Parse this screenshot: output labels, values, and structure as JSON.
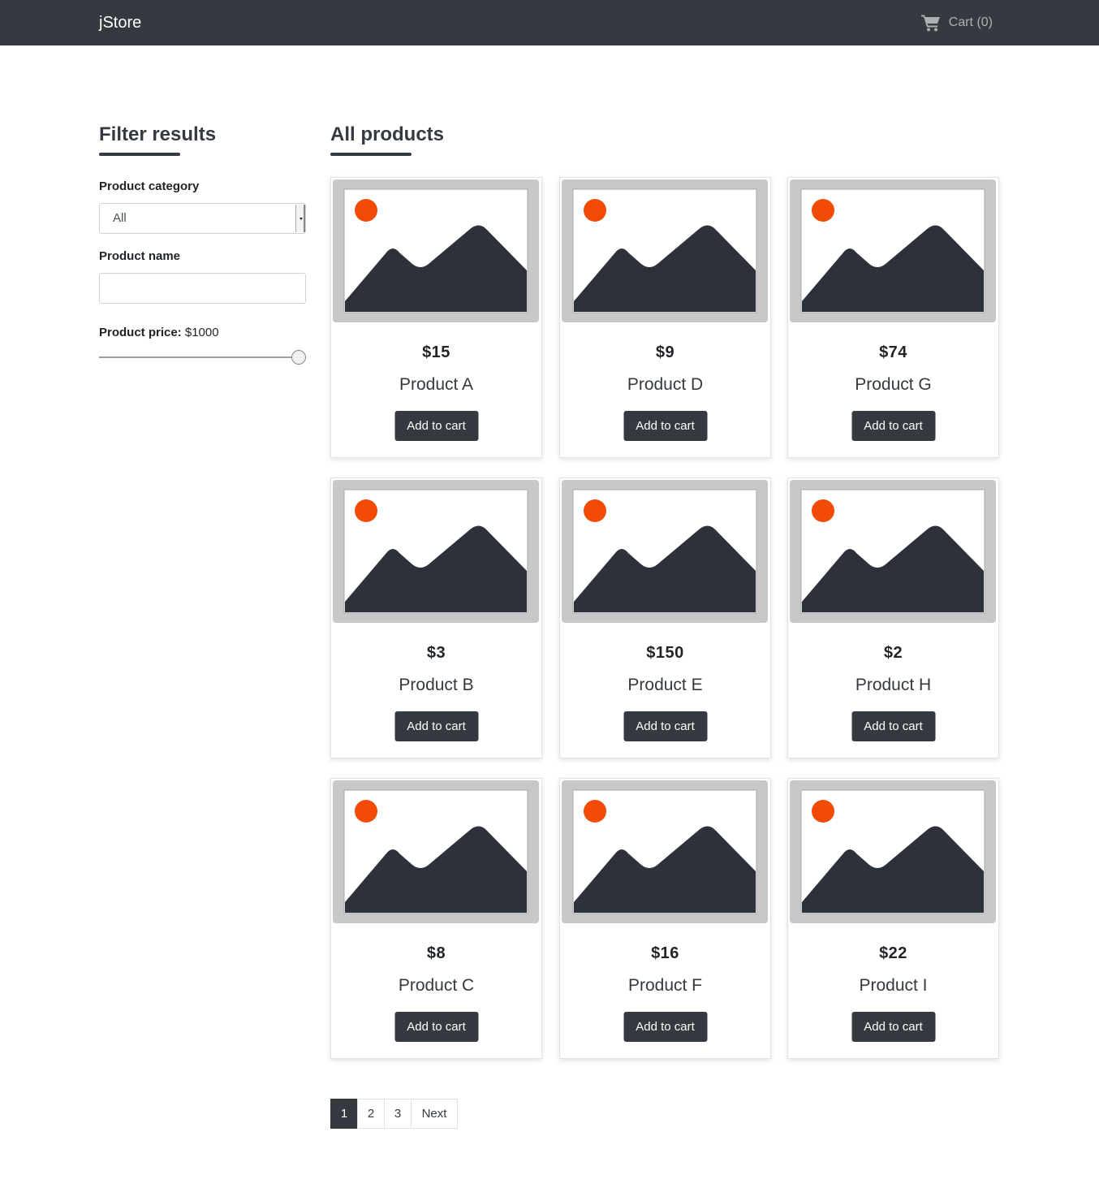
{
  "navbar": {
    "brand": "jStore",
    "cart_label": "Cart (0)",
    "cart_icon": "shopping-cart-icon"
  },
  "sidebar": {
    "title": "Filter results",
    "category_label": "Product category",
    "category_value": "All",
    "name_label": "Product name",
    "name_value": "",
    "price_label": "Product price:",
    "price_value": "$1000",
    "price_slider_fraction": 1.0
  },
  "main": {
    "title": "All products",
    "add_label": "Add to cart",
    "products": [
      {
        "price": "$15",
        "name": "Product A"
      },
      {
        "price": "$9",
        "name": "Product D"
      },
      {
        "price": "$74",
        "name": "Product G"
      },
      {
        "price": "$3",
        "name": "Product B"
      },
      {
        "price": "$150",
        "name": "Product E"
      },
      {
        "price": "$2",
        "name": "Product H"
      },
      {
        "price": "$8",
        "name": "Product C"
      },
      {
        "price": "$16",
        "name": "Product F"
      },
      {
        "price": "$22",
        "name": "Product I"
      }
    ]
  },
  "pagination": {
    "pages": [
      "1",
      "2",
      "3"
    ],
    "active": "1",
    "next": "Next"
  },
  "colors": {
    "dark": "#343a40",
    "accent": "#f24b07",
    "placeholder_frame": "#c8c8c8",
    "mountain": "#2c313a"
  }
}
